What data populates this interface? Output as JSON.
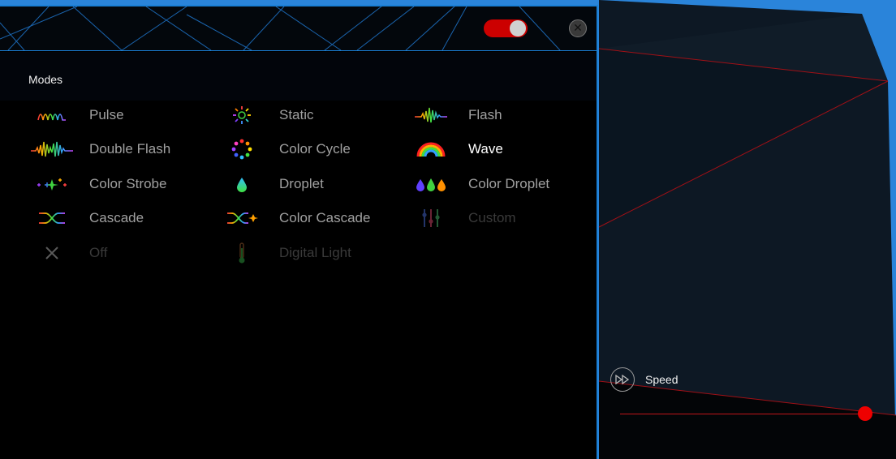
{
  "colors": {
    "accent": "#1a7fd6",
    "toggle_on": "#cc0000",
    "slider": "#ee0000"
  },
  "header": {
    "power_toggle": {
      "state": "on",
      "icon": "toggle-switch"
    },
    "close_icon": "close-icon"
  },
  "modes": {
    "title": "Modes",
    "items": [
      {
        "label": "Pulse",
        "icon": "pulse-icon",
        "state": "normal"
      },
      {
        "label": "Static",
        "icon": "static-icon",
        "state": "normal"
      },
      {
        "label": "Flash",
        "icon": "flash-icon",
        "state": "normal"
      },
      {
        "label": "Double Flash",
        "icon": "double-flash-icon",
        "state": "normal"
      },
      {
        "label": "Color Cycle",
        "icon": "color-cycle-icon",
        "state": "normal"
      },
      {
        "label": "Wave",
        "icon": "wave-icon",
        "state": "active"
      },
      {
        "label": "Color Strobe",
        "icon": "color-strobe-icon",
        "state": "normal"
      },
      {
        "label": "Droplet",
        "icon": "droplet-icon",
        "state": "normal"
      },
      {
        "label": "Color Droplet",
        "icon": "color-droplet-icon",
        "state": "normal"
      },
      {
        "label": "Cascade",
        "icon": "cascade-icon",
        "state": "normal"
      },
      {
        "label": "Color Cascade",
        "icon": "color-cascade-icon",
        "state": "normal"
      },
      {
        "label": "Custom",
        "icon": "custom-sliders-icon",
        "state": "disabled"
      },
      {
        "label": "Off",
        "icon": "off-x-icon",
        "state": "disabled"
      },
      {
        "label": "Digital Light",
        "icon": "thermometer-icon",
        "state": "disabled"
      }
    ]
  },
  "speed": {
    "label": "Speed",
    "icon": "fast-forward-icon",
    "value_fraction": 1.0
  }
}
